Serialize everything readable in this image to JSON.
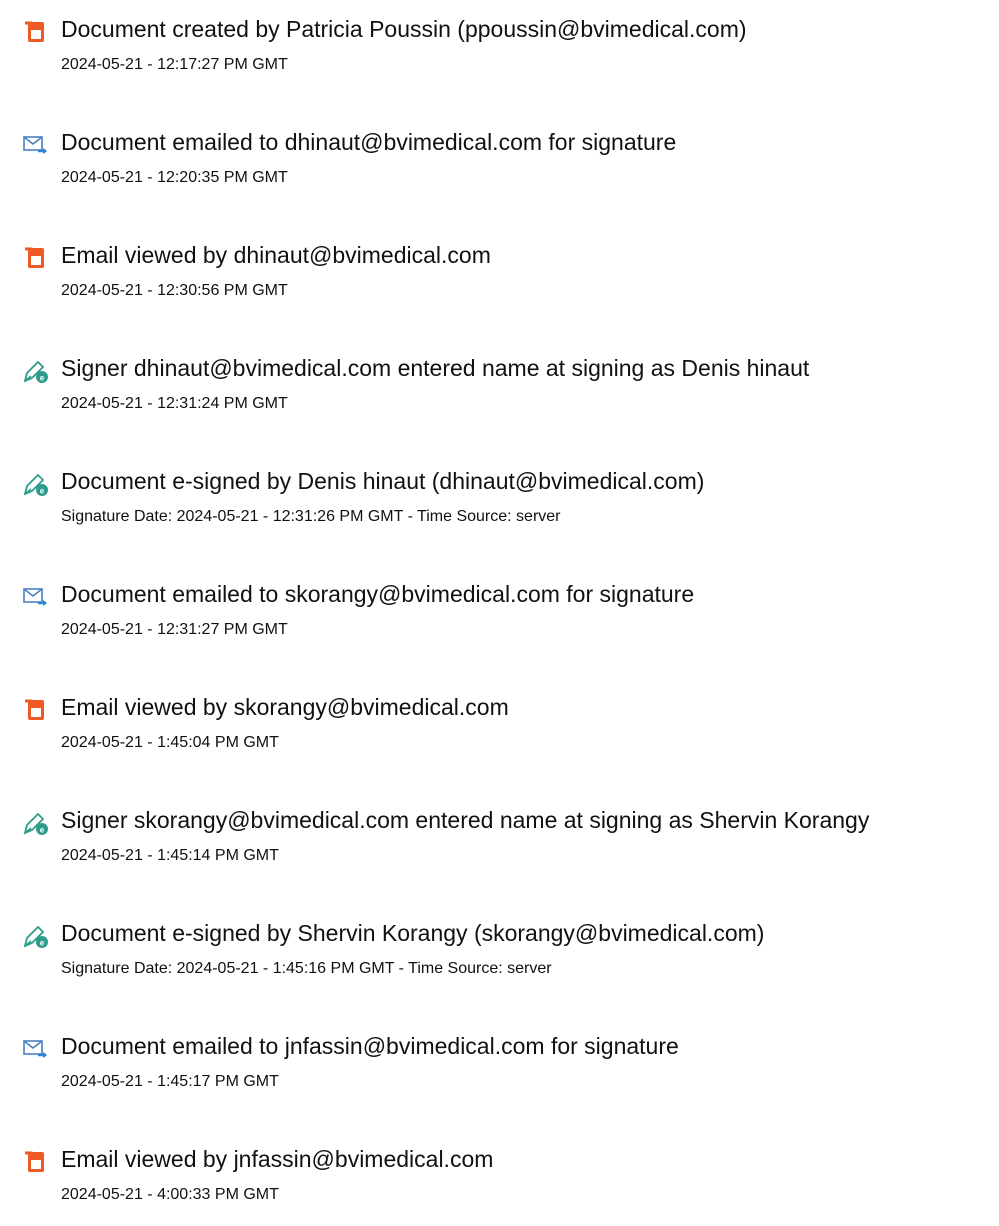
{
  "events": [
    {
      "icon": "document-created-icon",
      "title": "Document created by Patricia Poussin (ppoussin@bvimedical.com)",
      "meta": "2024-05-21 - 12:17:27 PM GMT"
    },
    {
      "icon": "email-sent-icon",
      "title": "Document emailed to dhinaut@bvimedical.com for signature",
      "meta": "2024-05-21 - 12:20:35 PM GMT"
    },
    {
      "icon": "document-viewed-icon",
      "title": "Email viewed by dhinaut@bvimedical.com",
      "meta": "2024-05-21 - 12:30:56 PM GMT"
    },
    {
      "icon": "pen-sign-icon",
      "title": "Signer dhinaut@bvimedical.com entered name at signing as Denis hinaut",
      "meta": "2024-05-21 - 12:31:24 PM GMT"
    },
    {
      "icon": "pen-sign-icon",
      "title": "Document e-signed by Denis hinaut (dhinaut@bvimedical.com)",
      "meta": "Signature Date: 2024-05-21 - 12:31:26 PM GMT - Time Source: server"
    },
    {
      "icon": "email-sent-icon",
      "title": "Document emailed to skorangy@bvimedical.com for signature",
      "meta": "2024-05-21 - 12:31:27 PM GMT"
    },
    {
      "icon": "document-viewed-icon",
      "title": "Email viewed by skorangy@bvimedical.com",
      "meta": "2024-05-21 - 1:45:04 PM GMT"
    },
    {
      "icon": "pen-sign-icon",
      "title": "Signer skorangy@bvimedical.com entered name at signing as Shervin Korangy",
      "meta": "2024-05-21 - 1:45:14 PM GMT"
    },
    {
      "icon": "pen-sign-icon",
      "title": "Document e-signed by Shervin Korangy (skorangy@bvimedical.com)",
      "meta": "Signature Date: 2024-05-21 - 1:45:16 PM GMT - Time Source: server"
    },
    {
      "icon": "email-sent-icon",
      "title": "Document emailed to jnfassin@bvimedical.com for signature",
      "meta": "2024-05-21 - 1:45:17 PM GMT"
    },
    {
      "icon": "document-viewed-icon",
      "title": "Email viewed by jnfassin@bvimedical.com",
      "meta": "2024-05-21 - 4:00:33 PM GMT"
    }
  ],
  "colors": {
    "document_icon": "#ef5a24",
    "email_icon_stroke": "#4a7fc1",
    "email_icon_arrow": "#2b84d6",
    "pen_icon_stroke": "#2e9c8b",
    "pen_icon_badge": "#2e9c8b"
  }
}
